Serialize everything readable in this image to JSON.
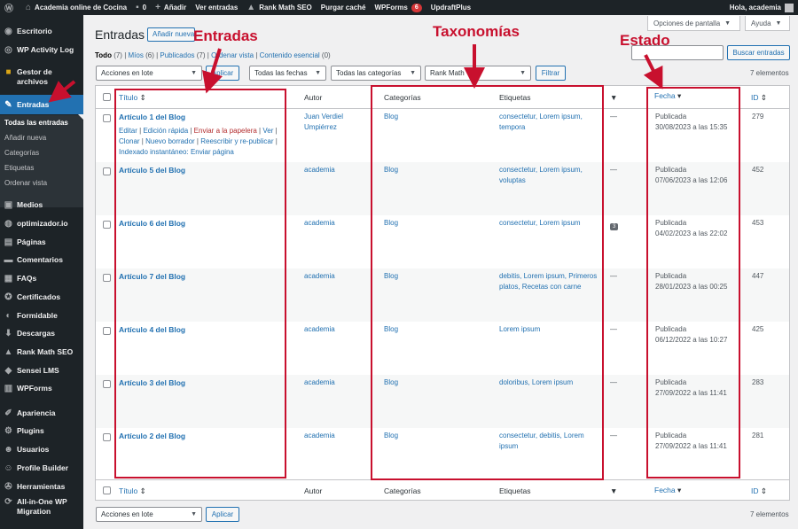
{
  "adminbar": {
    "site_name": "Academia online de Cocina",
    "comments_count": "0",
    "add_new": "Añadir",
    "view_posts": "Ver entradas",
    "rank_math": "Rank Math SEO",
    "purge_cache": "Purgar caché",
    "wpforms": "WPForms",
    "wpforms_badge": "6",
    "updraft": "UpdraftPlus",
    "greeting": "Hola, academia"
  },
  "sidebar": {
    "items": [
      {
        "label": "Escritorio",
        "icon": "dashboard-icon"
      },
      {
        "label": "WP Activity Log",
        "icon": "activity-log-icon"
      },
      {
        "label": "Gestor de archivos",
        "icon": "folder-icon"
      },
      {
        "label": "Entradas",
        "icon": "pin-icon"
      },
      {
        "label": "Medios",
        "icon": "media-icon"
      },
      {
        "label": "optimizador.io",
        "icon": "optimizer-icon"
      },
      {
        "label": "Páginas",
        "icon": "pages-icon"
      },
      {
        "label": "Comentarios",
        "icon": "comments-icon"
      },
      {
        "label": "FAQs",
        "icon": "faq-icon"
      },
      {
        "label": "Certificados",
        "icon": "certificate-icon"
      },
      {
        "label": "Formidable",
        "icon": "formidable-icon"
      },
      {
        "label": "Descargas",
        "icon": "download-icon"
      },
      {
        "label": "Rank Math SEO",
        "icon": "rankmath-icon"
      },
      {
        "label": "Sensei LMS",
        "icon": "sensei-icon"
      },
      {
        "label": "WPForms",
        "icon": "wpforms-icon"
      },
      {
        "label": "Apariencia",
        "icon": "appearance-icon"
      },
      {
        "label": "Plugins",
        "icon": "plugins-icon"
      },
      {
        "label": "Usuarios",
        "icon": "users-icon"
      },
      {
        "label": "Profile Builder",
        "icon": "profile-icon"
      },
      {
        "label": "Herramientas",
        "icon": "tools-icon"
      },
      {
        "label": "All-in-One WP Migration",
        "icon": "migration-icon"
      }
    ],
    "submenu": [
      "Todas las entradas",
      "Añadir nueva",
      "Categorías",
      "Etiquetas",
      "Ordenar vista"
    ]
  },
  "header": {
    "title": "Entradas",
    "add_new": "Añadir nueva",
    "screen_options": "Opciones de pantalla",
    "help": "Ayuda"
  },
  "views": [
    {
      "label": "Todo",
      "count": "(7)"
    },
    {
      "label": "Míos",
      "count": "(6)"
    },
    {
      "label": "Publicados",
      "count": "(7)"
    },
    {
      "label": "Ordenar vista",
      "count": ""
    },
    {
      "label": "Contenido esencial",
      "count": "(0)"
    }
  ],
  "search": {
    "button": "Buscar entradas",
    "placeholder": ""
  },
  "filters": {
    "bulk_actions": "Acciones en lote",
    "apply": "Aplicar",
    "dates": "Todas las fechas",
    "categories": "Todas las categorías",
    "rank_math": "Rank Math",
    "filter": "Filtrar",
    "items_count": "7 elementos"
  },
  "columns": {
    "title": "Título",
    "author": "Autor",
    "categories": "Categorías",
    "tags": "Etiquetas",
    "date": "Fecha",
    "id": "ID"
  },
  "row_actions": {
    "edit": "Editar",
    "quick_edit": "Edición rápida",
    "trash": "Enviar a la papelera",
    "view": "Ver",
    "clone": "Clonar",
    "new_draft": "Nuevo borrador",
    "rewrite": "Reescribir y re-publicar",
    "instant_index": "Indexado instantáneo: Enviar página"
  },
  "posts": [
    {
      "title": "Artículo 1 del Blog",
      "author_line1": "Juan Verdiel",
      "author_line2": "Umpiérrez",
      "category": "Blog",
      "tags_line1": "consectetur, Lorem ipsum,",
      "tags_line2": "tempora",
      "comments": "—",
      "status": "Publicada",
      "date": "30/08/2023 a las 15:35",
      "id": "279"
    },
    {
      "title": "Artículo 5 del Blog",
      "author_line1": "academia",
      "author_line2": "",
      "category": "Blog",
      "tags_line1": "consectetur, Lorem ipsum,",
      "tags_line2": "voluptas",
      "comments": "—",
      "status": "Publicada",
      "date": "07/06/2023 a las 12:06",
      "id": "452"
    },
    {
      "title": "Artículo 6 del Blog",
      "author_line1": "academia",
      "author_line2": "",
      "category": "Blog",
      "tags_line1": "consectetur, Lorem ipsum",
      "tags_line2": "",
      "comments": "3",
      "status": "Publicada",
      "date": "04/02/2023 a las 22:02",
      "id": "453"
    },
    {
      "title": "Artículo 7 del Blog",
      "author_line1": "academia",
      "author_line2": "",
      "category": "Blog",
      "tags_line1": "debitis, Lorem ipsum, Primeros",
      "tags_line2": "platos, Recetas con carne",
      "comments": "—",
      "status": "Publicada",
      "date": "28/01/2023 a las 00:25",
      "id": "447"
    },
    {
      "title": "Artículo 4 del Blog",
      "author_line1": "academia",
      "author_line2": "",
      "category": "Blog",
      "tags_line1": "Lorem ipsum",
      "tags_line2": "",
      "comments": "—",
      "status": "Publicada",
      "date": "06/12/2022 a las 10:27",
      "id": "425"
    },
    {
      "title": "Artículo 3 del Blog",
      "author_line1": "academia",
      "author_line2": "",
      "category": "Blog",
      "tags_line1": "doloribus, Lorem ipsum",
      "tags_line2": "",
      "comments": "—",
      "status": "Publicada",
      "date": "27/09/2022 a las 11:41",
      "id": "283"
    },
    {
      "title": "Artículo 2 del Blog",
      "author_line1": "academia",
      "author_line2": "",
      "category": "Blog",
      "tags_line1": "consectetur, debitis, Lorem",
      "tags_line2": "ipsum",
      "comments": "—",
      "status": "Publicada",
      "date": "27/09/2022 a las 11:41",
      "id": "281"
    }
  ],
  "annotations": {
    "entradas": "Entradas",
    "taxonomias": "Taxonomías",
    "estado": "Estado"
  },
  "colors": {
    "annotation": "#c8102e",
    "accent": "#2271b1",
    "adminbar": "#1d2327"
  }
}
